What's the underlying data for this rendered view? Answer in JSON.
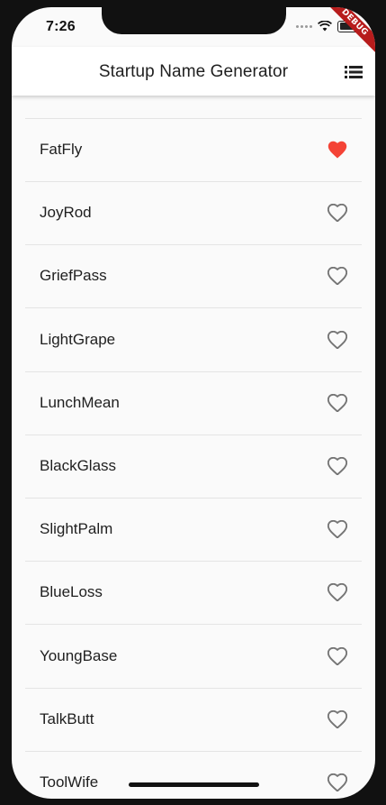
{
  "status_bar": {
    "time": "7:26"
  },
  "debug_banner": "DEBUG",
  "app_bar": {
    "title": "Startup Name Generator",
    "action_icon": "list-icon"
  },
  "colors": {
    "favorite": "#f44336",
    "unfavorited": "#757575",
    "app_bar_bg": "#ffffff"
  },
  "suggestions": [
    {
      "name": "FatFly",
      "saved": true
    },
    {
      "name": "JoyRod",
      "saved": false
    },
    {
      "name": "GriefPass",
      "saved": false
    },
    {
      "name": "LightGrape",
      "saved": false
    },
    {
      "name": "LunchMean",
      "saved": false
    },
    {
      "name": "BlackGlass",
      "saved": false
    },
    {
      "name": "SlightPalm",
      "saved": false
    },
    {
      "name": "BlueLoss",
      "saved": false
    },
    {
      "name": "YoungBase",
      "saved": false
    },
    {
      "name": "TalkButt",
      "saved": false
    },
    {
      "name": "ToolWife",
      "saved": false
    }
  ]
}
